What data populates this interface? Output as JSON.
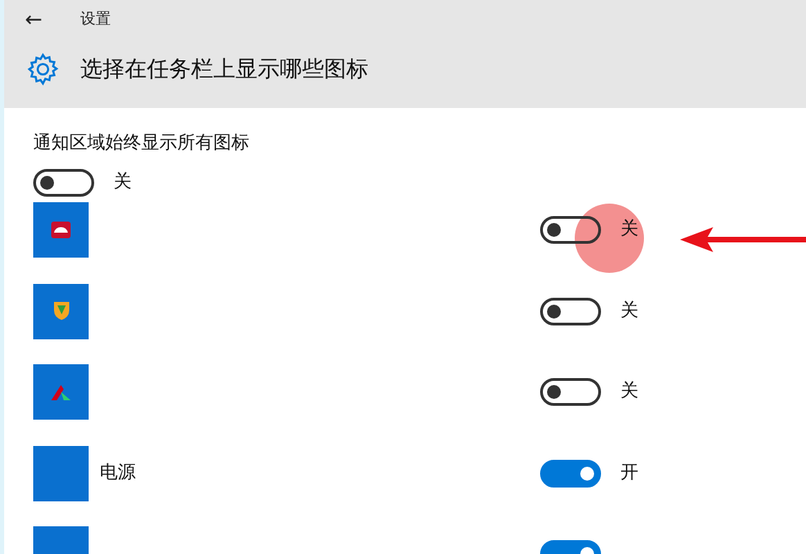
{
  "header": {
    "back": "←",
    "section": "设置",
    "title": "选择在任务栏上显示哪些图标"
  },
  "always_show": {
    "label": "通知区域始终显示所有图标",
    "on": false,
    "state_text": "关"
  },
  "items": [
    {
      "on": false,
      "state_text": "关"
    },
    {
      "on": false,
      "state_text": "关"
    },
    {
      "on": false,
      "state_text": "关"
    },
    {
      "label": "电源",
      "on": true,
      "state_text": "开"
    },
    {
      "on": true
    }
  ]
}
